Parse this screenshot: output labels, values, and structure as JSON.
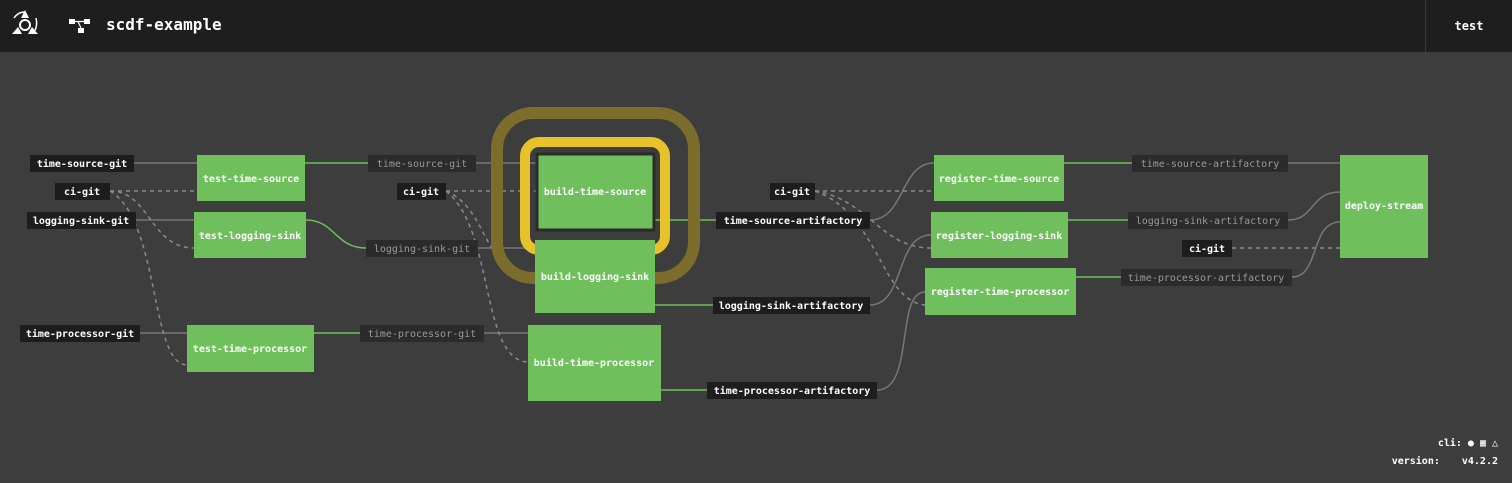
{
  "header": {
    "pipeline_name": "scdf-example",
    "team": "test"
  },
  "footer": {
    "cli_label": "cli:",
    "version_label": "version:",
    "version_value": "v4.2.2",
    "os_icons": [
      "apple-icon",
      "windows-icon",
      "linux-icon"
    ]
  },
  "colors": {
    "job_succeeded": "#6fbf5d",
    "running_ring": "#e8c22a",
    "header_bg": "#1e1e1e",
    "canvas_bg": "#3d3d3d"
  },
  "graph": {
    "jobs": {
      "test_time_source": "test-time-source",
      "test_logging_sink": "test-logging-sink",
      "test_time_processor": "test-time-processor",
      "build_time_source": "build-time-source",
      "build_logging_sink": "build-logging-sink",
      "build_time_processor": "build-time-processor",
      "register_time_source": "register-time-source",
      "register_logging_sink": "register-logging-sink",
      "register_time_processor": "register-time-processor",
      "deploy_stream": "deploy-stream"
    },
    "resources": {
      "time_source_git_in": "time-source-git",
      "ci_git_1": "ci-git",
      "logging_sink_git_in": "logging-sink-git",
      "time_processor_git_in": "time-processor-git",
      "time_source_git_pass": "time-source-git",
      "ci_git_2": "ci-git",
      "logging_sink_git_pass": "logging-sink-git",
      "time_processor_git_pass": "time-processor-git",
      "time_source_artifactory": "time-source-artifactory",
      "logging_sink_artifactory": "logging-sink-artifactory",
      "time_processor_artifactory": "time-processor-artifactory",
      "ci_git_3": "ci-git",
      "time_source_artifactory_pass": "time-source-artifactory",
      "logging_sink_artifactory_pass": "logging-sink-artifactory",
      "time_processor_artifactory_pass": "time-processor-artifactory",
      "ci_git_4": "ci-git"
    }
  }
}
